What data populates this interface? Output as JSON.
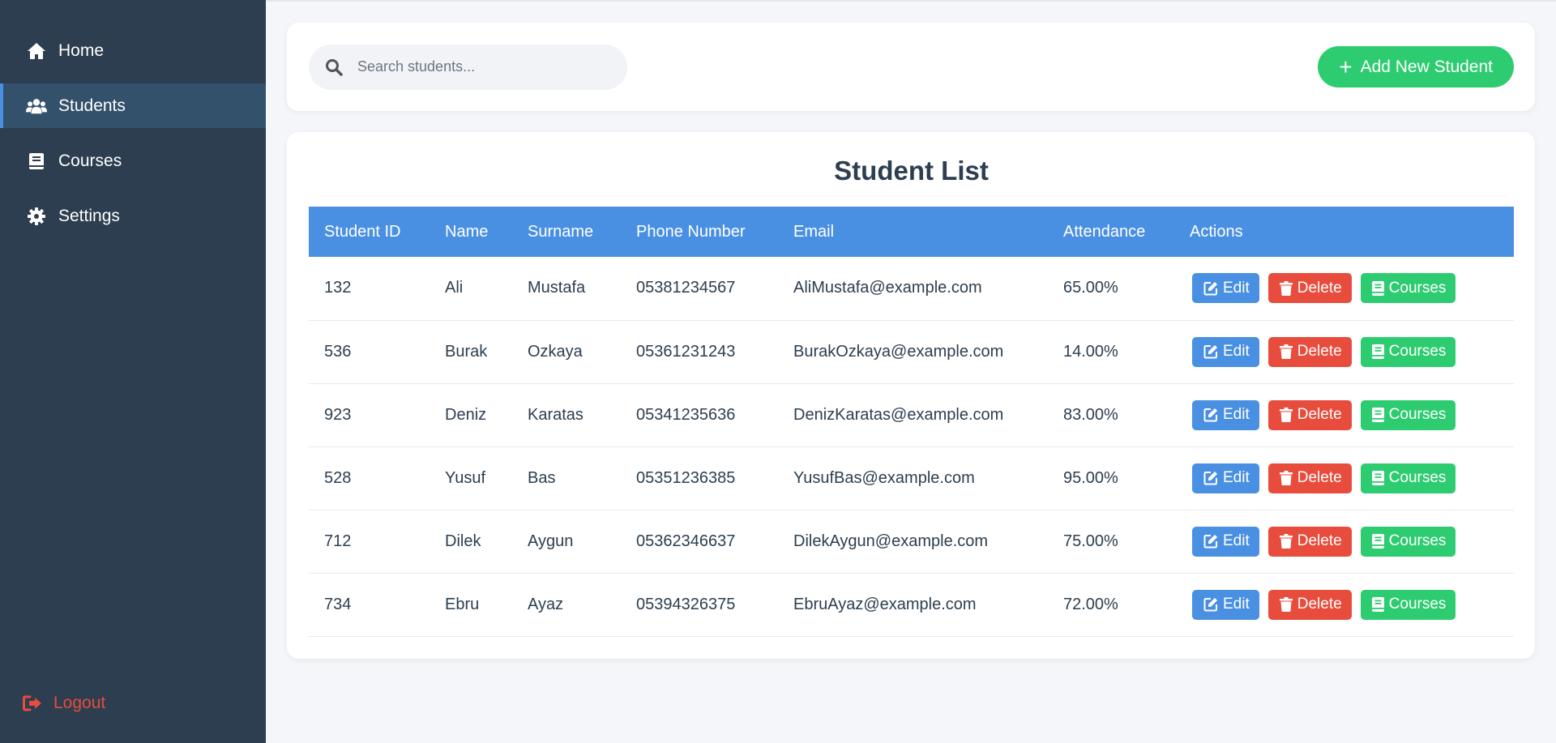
{
  "sidebar": {
    "items": [
      {
        "label": "Home",
        "icon": "home-icon",
        "active": false
      },
      {
        "label": "Students",
        "icon": "users-icon",
        "active": true
      },
      {
        "label": "Courses",
        "icon": "book-icon",
        "active": false
      },
      {
        "label": "Settings",
        "icon": "gear-icon",
        "active": false
      }
    ],
    "logout_label": "Logout"
  },
  "topbar": {
    "search_placeholder": "Search students...",
    "add_button_label": "Add New Student"
  },
  "student_list": {
    "title": "Student List",
    "columns": [
      "Student ID",
      "Name",
      "Surname",
      "Phone Number",
      "Email",
      "Attendance",
      "Actions"
    ],
    "rows": [
      {
        "id": "132",
        "name": "Ali",
        "surname": "Mustafa",
        "phone": "05381234567",
        "email": "AliMustafa@example.com",
        "attendance": "65.00%"
      },
      {
        "id": "536",
        "name": "Burak",
        "surname": "Ozkaya",
        "phone": "05361231243",
        "email": "BurakOzkaya@example.com",
        "attendance": "14.00%"
      },
      {
        "id": "923",
        "name": "Deniz",
        "surname": "Karatas",
        "phone": "05341235636",
        "email": "DenizKaratas@example.com",
        "attendance": "83.00%"
      },
      {
        "id": "528",
        "name": "Yusuf",
        "surname": "Bas",
        "phone": "05351236385",
        "email": "YusufBas@example.com",
        "attendance": "95.00%"
      },
      {
        "id": "712",
        "name": "Dilek",
        "surname": "Aygun",
        "phone": "05362346637",
        "email": "DilekAygun@example.com",
        "attendance": "75.00%"
      },
      {
        "id": "734",
        "name": "Ebru",
        "surname": "Ayaz",
        "phone": "05394326375",
        "email": "EbruAyaz@example.com",
        "attendance": "72.00%"
      }
    ],
    "action_labels": {
      "edit": "Edit",
      "delete": "Delete",
      "courses": "Courses"
    }
  },
  "colors": {
    "sidebar_bg": "#2c3e50",
    "active_item_bg": "#34516c",
    "accent_blue": "#4a90e2",
    "danger_red": "#e74c3c",
    "success_green": "#2ecc71"
  }
}
